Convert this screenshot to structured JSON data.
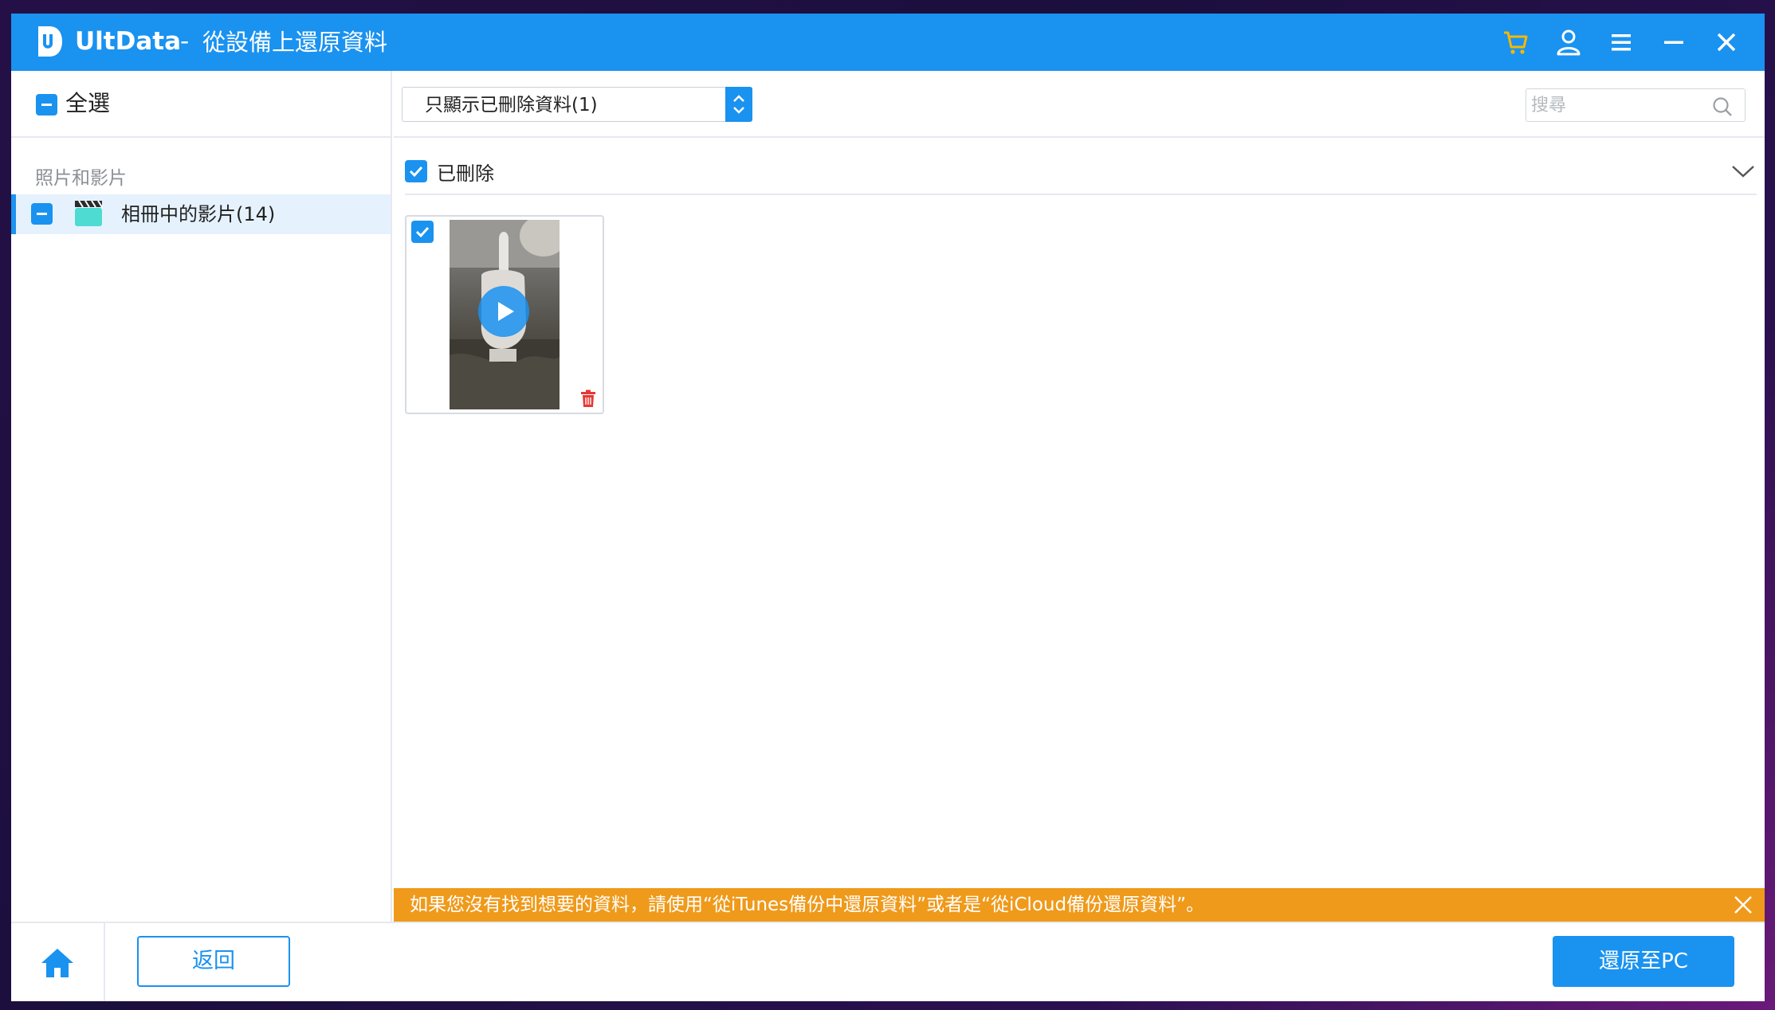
{
  "app": {
    "name": "UltData",
    "separator": "-",
    "subtitle": "從設備上還原資料"
  },
  "toolbar_icons": [
    "cart-icon",
    "user-icon",
    "menu-icon",
    "minimize-icon",
    "close-icon"
  ],
  "colors": {
    "accent": "#1a92f0",
    "notice": "#ef9a1b",
    "cart": "#f5b800",
    "delete": "#e53935"
  },
  "sidebar": {
    "select_all_label": "全選",
    "group_label": "照片和影片",
    "items": [
      {
        "label": "相冊中的影片(14)",
        "selected": true
      }
    ]
  },
  "filter": {
    "selected": "只顯示已刪除資料(1)"
  },
  "search": {
    "placeholder": "搜尋"
  },
  "section": {
    "label": "已刪除",
    "checked": true
  },
  "thumbnails": [
    {
      "type": "video",
      "checked": true
    }
  ],
  "notice": {
    "text": "如果您沒有找到想要的資料，請使用“從iTunes備份中還原資料”或者是“從iCloud備份還原資料”。"
  },
  "footer": {
    "back_label": "返回",
    "recover_label": "還原至PC"
  }
}
